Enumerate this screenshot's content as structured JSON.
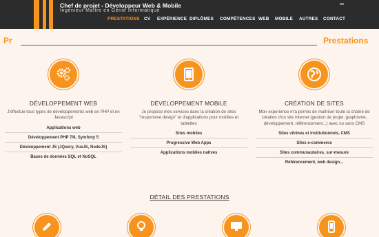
{
  "header": {
    "title": "Chef de projet - Développeur Web & Mobile",
    "subtitle": "Ingénieur Maître en Génie Informatique",
    "language_icon": "uk-flag-icon"
  },
  "nav": {
    "items": [
      {
        "label": "PRESTATIONS",
        "active": true
      },
      {
        "label": "CV"
      },
      {
        "label": "EXPÉRIENCE"
      },
      {
        "label": "DIPLÔMES"
      },
      {
        "label": "COMPÉTENCES"
      },
      {
        "label": "WEB"
      },
      {
        "label": "MOBILE"
      },
      {
        "label": "AUTRES"
      },
      {
        "label": "CONTACT"
      }
    ]
  },
  "banner": {
    "left_text": "Pr",
    "right_text": "Prestations"
  },
  "services": [
    {
      "icon": "gears-icon",
      "title": "DÉVELOPPEMENT WEB",
      "description": "J'effectue tous types de développements web en PHP et en Javascript",
      "items": [
        "Applications web",
        "Développement PHP 7/8, Symfony 5",
        "Développement JS (JQuery, VueJS, NodeJS)",
        "Bases de données SQL et NoSQL"
      ]
    },
    {
      "icon": "tablet-icon",
      "title": "DÉVELOPPEMENT MOBILE",
      "description": "Je propose mes services dans la création de sites \"responsive design\" et d'applications pour mobiles et tablettes",
      "items": [
        "Sites mobiles",
        "Progressive Web Apps",
        "Applications mobiles natives"
      ]
    },
    {
      "icon": "globe-icon",
      "title": "CRÉATION DE SITES",
      "description": "Mon experience m'a permis de maîtriser toute la chaîne de création d'un site internet (gestion de projet, graphisme, développement, référencement...) avec ou sans CMS",
      "items": [
        "Sites vitrines et institutionnels, CMS",
        "Sites e-commerce",
        "Sites communautaires, sur-mesure",
        "Référencement, web design..."
      ]
    }
  ],
  "detail": {
    "title": "DÉTAIL DES PRESTATIONS",
    "icons": [
      "pencil-icon",
      "lightbulb-icon",
      "monitor-icon",
      "smartphone-icon"
    ]
  },
  "colors": {
    "accent": "#f7941d",
    "header_bg": "#2c2c2c",
    "page_bg": "#fdf4ee"
  }
}
